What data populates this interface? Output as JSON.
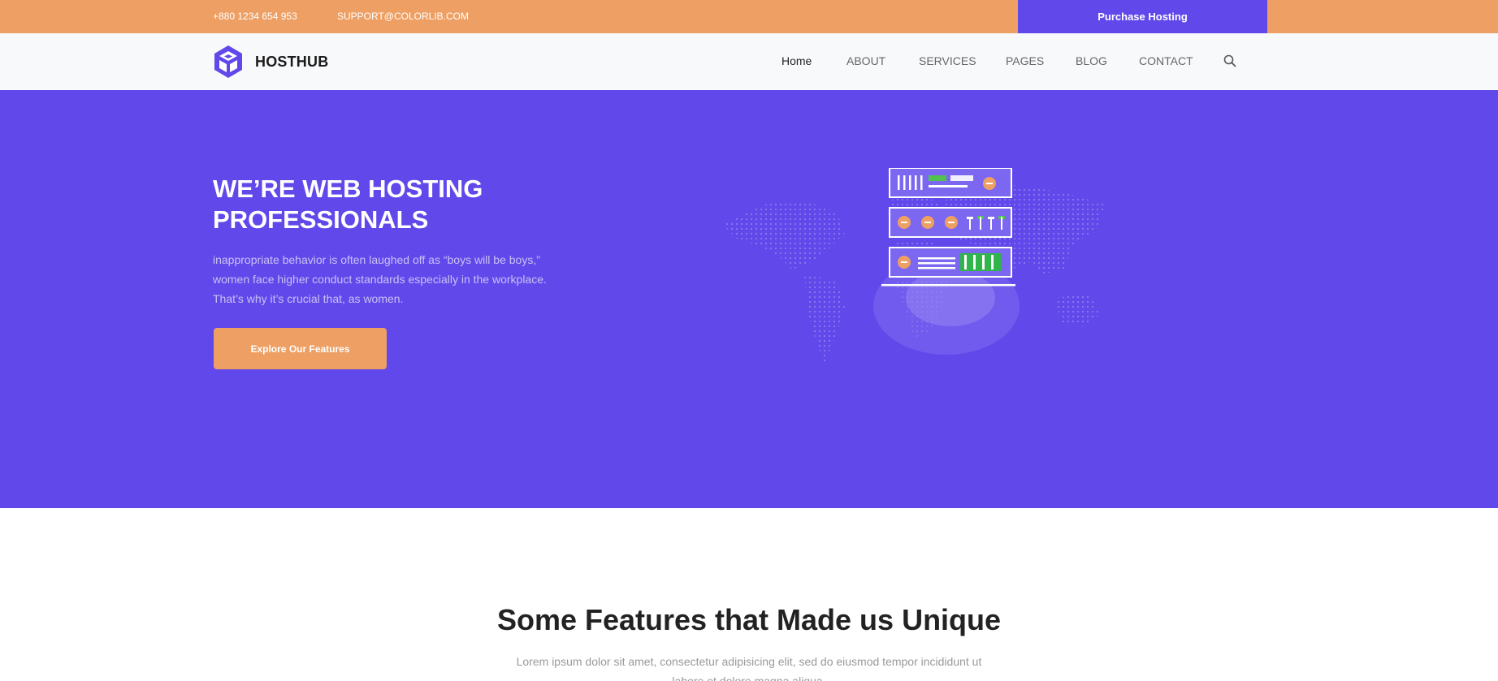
{
  "topbar": {
    "phone": "+880 1234 654 953",
    "email": "SUPPORT@COLORLIB.COM",
    "purchase_label": "Purchase Hosting"
  },
  "navbar": {
    "brand": "HOSTHUB",
    "items": [
      {
        "label": "Home",
        "active": true
      },
      {
        "label": "ABOUT"
      },
      {
        "label": "SERVICES"
      },
      {
        "label": "PAGES"
      },
      {
        "label": "BLOG"
      },
      {
        "label": "CONTACT"
      }
    ],
    "search_icon": "search-icon"
  },
  "hero": {
    "title": "WE’RE WEB HOSTING PROFESSIONALS",
    "lead": "inappropriate behavior is often laughed off as “boys will be boys,” women face higher conduct standards especially in the workplace. That’s why it’s crucial that, as women.",
    "cta_label": "Explore Our Features",
    "illustration": "server-rack-world-map-illustration"
  },
  "features": {
    "title": "Some Features that Made us Unique",
    "description": "Lorem ipsum dolor sit amet, consectetur adipisicing elit, sed do eiusmod tempor incididunt ut labore et dolore magna aliqua."
  },
  "colors": {
    "accent_orange": "#ee9f63",
    "brand_purple": "#6148ea"
  }
}
